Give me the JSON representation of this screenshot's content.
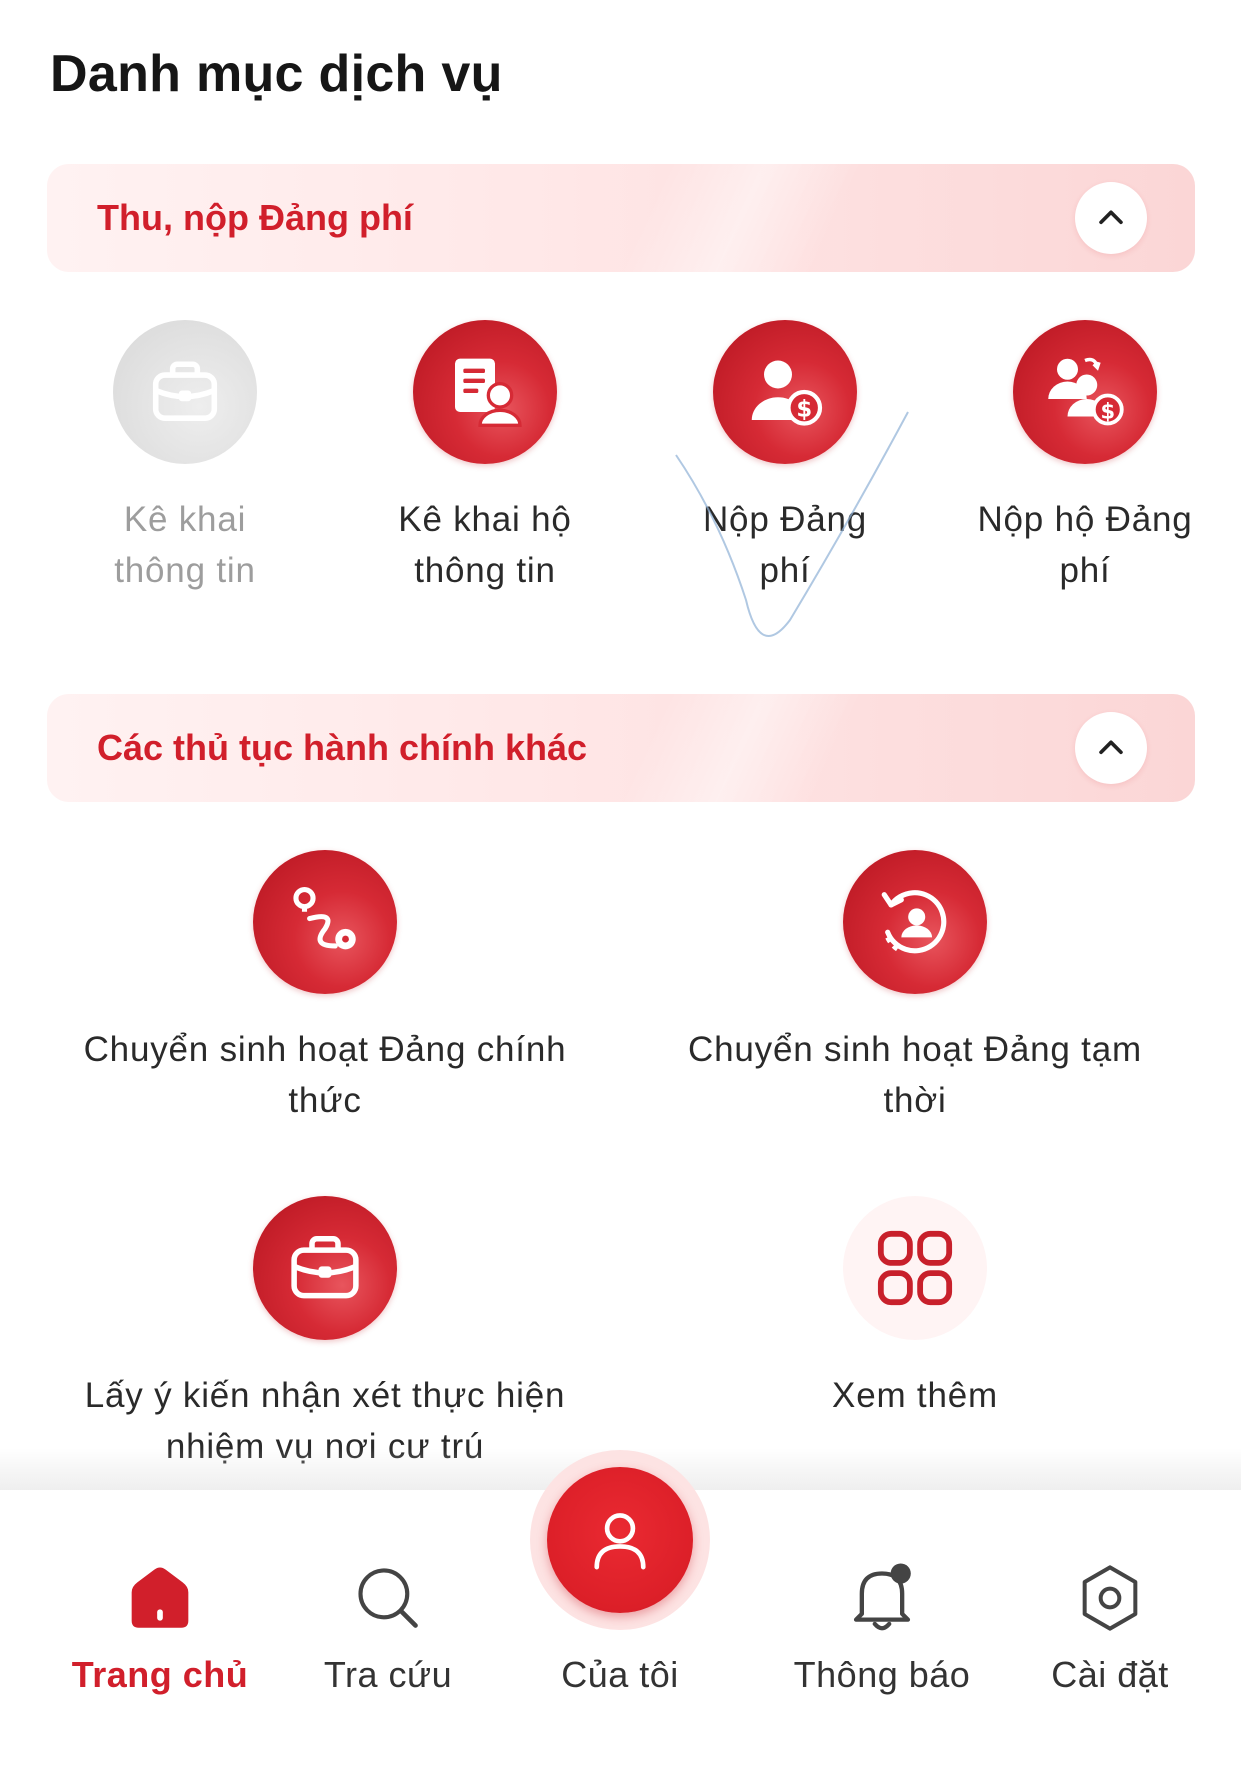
{
  "page": {
    "title": "Danh mục dịch vụ"
  },
  "sections": [
    {
      "title": "Thu, nộp Đảng phí",
      "items": [
        {
          "label": "Kê khai thông tin",
          "icon": "briefcase-icon",
          "enabled": false
        },
        {
          "label": "Kê khai hộ thông tin",
          "icon": "document-user-icon",
          "enabled": true
        },
        {
          "label": "Nộp Đảng phí",
          "icon": "user-dollar-icon",
          "enabled": true
        },
        {
          "label": "Nộp hộ Đảng phí",
          "icon": "users-dollar-icon",
          "enabled": true
        }
      ]
    },
    {
      "title": "Các thủ tục hành chính khác",
      "items": [
        {
          "label": "Chuyển sinh hoạt Đảng chính thức",
          "icon": "route-icon",
          "enabled": true
        },
        {
          "label": "Chuyển sinh hoạt Đảng tạm thời",
          "icon": "user-rotate-icon",
          "enabled": true
        },
        {
          "label": "Lấy ý kiến nhận xét thực hiện nhiệm vụ nơi cư trú",
          "icon": "briefcase-icon",
          "enabled": true
        },
        {
          "label": "Xem thêm",
          "icon": "grid-icon",
          "enabled": true
        }
      ]
    }
  ],
  "tabbar": {
    "items": [
      {
        "label": "Trang chủ",
        "icon": "home-icon",
        "active": true
      },
      {
        "label": "Tra cứu",
        "icon": "search-icon",
        "active": false
      },
      {
        "label": "Của tôi",
        "icon": "user-icon",
        "active": false
      },
      {
        "label": "Thông báo",
        "icon": "bell-icon",
        "active": false
      },
      {
        "label": "Cài đặt",
        "icon": "settings-icon",
        "active": false
      }
    ]
  },
  "colors": {
    "brand_red": "#d11f2b",
    "header_bg": "#ffe7e7",
    "disabled_gray": "#9d9d9d"
  }
}
